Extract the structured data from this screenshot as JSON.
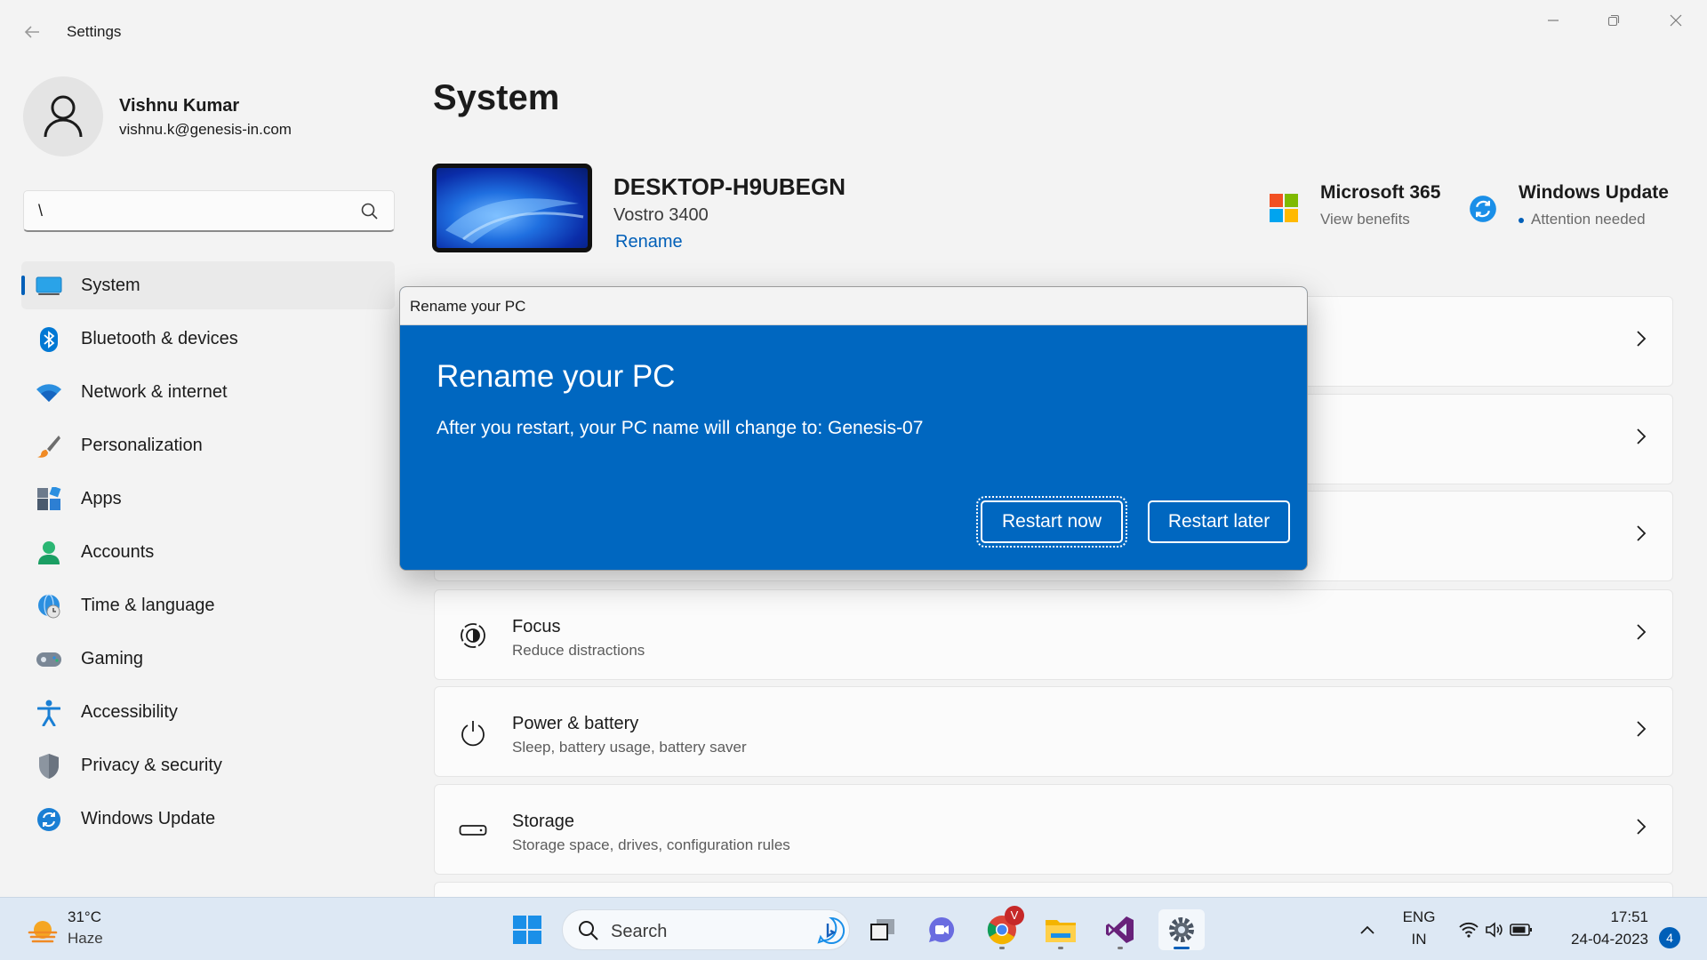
{
  "window": {
    "app_title": "Settings",
    "controls": [
      "minimize",
      "restore",
      "close"
    ]
  },
  "profile": {
    "name": "Vishnu Kumar",
    "email": "vishnu.k@genesis-in.com"
  },
  "search": {
    "value": "\\",
    "icon": "search-icon"
  },
  "sidebar": {
    "items": [
      {
        "label": "System",
        "icon": "system-display-icon",
        "active": true
      },
      {
        "label": "Bluetooth & devices",
        "icon": "bluetooth-icon"
      },
      {
        "label": "Network & internet",
        "icon": "wifi-icon"
      },
      {
        "label": "Personalization",
        "icon": "paintbrush-icon"
      },
      {
        "label": "Apps",
        "icon": "apps-icon"
      },
      {
        "label": "Accounts",
        "icon": "accounts-icon"
      },
      {
        "label": "Time & language",
        "icon": "globe-clock-icon"
      },
      {
        "label": "Gaming",
        "icon": "gamepad-icon"
      },
      {
        "label": "Accessibility",
        "icon": "accessibility-icon"
      },
      {
        "label": "Privacy & security",
        "icon": "shield-icon"
      },
      {
        "label": "Windows Update",
        "icon": "update-icon"
      }
    ]
  },
  "main": {
    "title": "System",
    "device": {
      "name": "DESKTOP-H9UBEGN",
      "model": "Vostro 3400",
      "rename_label": "Rename"
    },
    "promos": [
      {
        "title": "Microsoft 365",
        "subtitle": "View benefits",
        "icon": "microsoft-logo-icon"
      },
      {
        "title": "Windows Update",
        "subtitle": "Attention needed",
        "icon": "update-icon"
      }
    ],
    "cards": [
      {
        "title": "Focus",
        "subtitle": "Reduce distractions",
        "icon": "focus-icon"
      },
      {
        "title": "Power & battery",
        "subtitle": "Sleep, battery usage, battery saver",
        "icon": "power-icon"
      },
      {
        "title": "Storage",
        "subtitle": "Storage space, drives, configuration rules",
        "icon": "storage-icon"
      }
    ]
  },
  "dialog": {
    "window_title": "Rename your PC",
    "heading": "Rename your PC",
    "message": "After you restart, your PC name will change to: Genesis-07",
    "primary_button": "Restart now",
    "secondary_button": "Restart later"
  },
  "taskbar": {
    "weather": {
      "temp": "31°C",
      "condition": "Haze"
    },
    "search_label": "Search",
    "pinned": [
      "windows-start-icon",
      "search",
      "task-view-icon",
      "teams-chat-icon",
      "chrome-icon",
      "file-explorer-icon",
      "visual-studio-icon",
      "settings-gear-icon"
    ],
    "chrome_badge": "V",
    "tray": {
      "language_line1": "ENG",
      "language_line2": "IN",
      "time": "17:51",
      "date": "24-04-2023",
      "notification_count": "4"
    }
  },
  "colors": {
    "accent": "#005fb8",
    "dialog_bg": "#0067c0",
    "page_bg": "#f3f3f3",
    "taskbar_bg": "#dde8f4"
  }
}
